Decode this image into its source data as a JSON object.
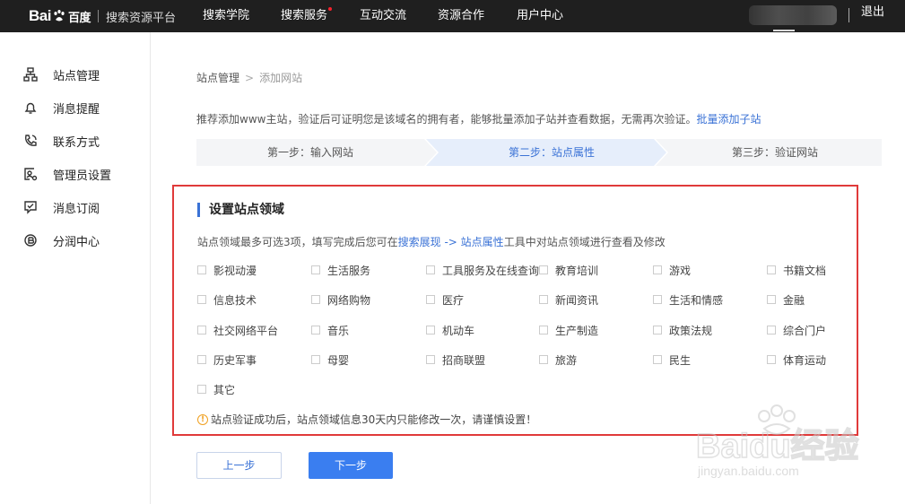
{
  "header": {
    "logo_text": "Bai",
    "logo_cn": "百度",
    "platform": "搜索资源平台",
    "nav": [
      "搜索学院",
      "搜索服务",
      "互动交流",
      "资源合作",
      "用户中心"
    ],
    "logout": "退出"
  },
  "sidebar": {
    "items": [
      {
        "label": "站点管理",
        "icon": "sitemap-icon"
      },
      {
        "label": "消息提醒",
        "icon": "bell-icon"
      },
      {
        "label": "联系方式",
        "icon": "phone-icon"
      },
      {
        "label": "管理员设置",
        "icon": "admin-icon"
      },
      {
        "label": "消息订阅",
        "icon": "subscribe-icon"
      },
      {
        "label": "分润中心",
        "icon": "revenue-icon"
      }
    ]
  },
  "breadcrumb": {
    "root": "站点管理",
    "sep": ">",
    "current": "添加网站"
  },
  "intro": {
    "text": "推荐添加www主站，验证后可证明您是该域名的拥有者，能够批量添加子站并查看数据，无需再次验证。",
    "link": "批量添加子站"
  },
  "steps": [
    {
      "label": "第一步：输入网站",
      "active": false
    },
    {
      "label": "第二步：站点属性",
      "active": true
    },
    {
      "label": "第三步：验证网站",
      "active": false
    }
  ],
  "domain_card": {
    "title": "设置站点领域",
    "desc_pre": "站点领域最多可选3项，填写完成后您可在",
    "desc_link1": "搜索展现",
    "desc_arrow": " -> ",
    "desc_link2": "站点属性",
    "desc_post": "工具中对站点领域进行查看及修改",
    "options": [
      "影视动漫",
      "生活服务",
      "工具服务及在线查询",
      "教育培训",
      "游戏",
      "书籍文档",
      "信息技术",
      "网络购物",
      "医疗",
      "新闻资讯",
      "生活和情感",
      "金融",
      "社交网络平台",
      "音乐",
      "机动车",
      "生产制造",
      "政策法规",
      "综合门户",
      "历史军事",
      "母婴",
      "招商联盟",
      "旅游",
      "民生",
      "体育运动",
      "其它"
    ],
    "warning": "站点验证成功后，站点领域信息30天内只能修改一次，请谨慎设置！"
  },
  "buttons": {
    "prev": "上一步",
    "next": "下一步"
  },
  "watermark": {
    "brand": "Baidu经验",
    "url": "jingyan.baidu.com"
  },
  "colors": {
    "accent": "#3a72d6",
    "primary_button": "#3a7ef0",
    "highlight_border": "#e03a3a",
    "topbar": "#1f1f1f",
    "step_active_bg": "#e6eefb"
  }
}
